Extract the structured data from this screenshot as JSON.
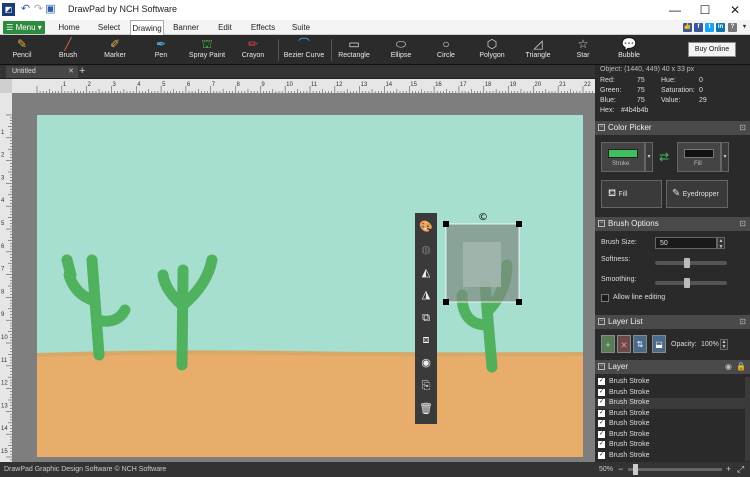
{
  "window": {
    "title": "DrawPad by NCH Software",
    "minimize": "—",
    "maximize": "☐",
    "close": "✕"
  },
  "menu_button": "Menu",
  "ribbon_tabs": [
    "Home",
    "Select",
    "Drawing",
    "Banner",
    "Edit",
    "Effects",
    "Suite"
  ],
  "active_tab": "Drawing",
  "tools": [
    {
      "label": "Pencil",
      "icon": "pencil-icon",
      "color": "#e0b040"
    },
    {
      "label": "Brush",
      "icon": "brush-icon",
      "color": "#d9693a"
    },
    {
      "label": "Marker",
      "icon": "marker-icon",
      "color": "#e0b040"
    },
    {
      "label": "Pen",
      "icon": "pen-icon",
      "color": "#4aa0e0"
    },
    {
      "label": "Spray Paint",
      "icon": "spray-paint-icon",
      "color": "#4ab84a"
    },
    {
      "label": "Crayon",
      "icon": "crayon-icon",
      "color": "#e04040"
    },
    {
      "label": "Bezier Curve",
      "icon": "bezier-curve-icon",
      "color": "#4aa0e0"
    },
    {
      "label": "Rectangle",
      "icon": "rectangle-icon",
      "color": "#cccccc"
    },
    {
      "label": "Ellipse",
      "icon": "ellipse-icon",
      "color": "#cccccc"
    },
    {
      "label": "Circle",
      "icon": "circle-icon",
      "color": "#cccccc"
    },
    {
      "label": "Polygon",
      "icon": "polygon-icon",
      "color": "#cccccc"
    },
    {
      "label": "Triangle",
      "icon": "triangle-icon",
      "color": "#cccccc"
    },
    {
      "label": "Star",
      "icon": "star-icon",
      "color": "#cccccc"
    },
    {
      "label": "Bubble",
      "icon": "bubble-icon",
      "color": "#cccccc"
    }
  ],
  "buy_online": "Buy Online",
  "document_tab": "Untitled",
  "status_text": "DrawPad Graphic Design Software © NCH Software",
  "ruler_top_labels": [
    "1",
    "2",
    "3",
    "4",
    "5",
    "6",
    "7",
    "8",
    "9",
    "10",
    "11",
    "12",
    "13",
    "14",
    "15",
    "16",
    "17",
    "18",
    "19",
    "20",
    "21",
    "22"
  ],
  "ruler_left_labels": [
    "1",
    "2",
    "3",
    "4",
    "5",
    "6",
    "7",
    "8",
    "9",
    "10",
    "11",
    "12",
    "13",
    "14",
    "15"
  ],
  "color_info": {
    "object_line": "Object:   (1440, 449) 40 x 33 px",
    "red_label": "Red:",
    "red": "75",
    "hue_label": "Hue:",
    "hue": "0",
    "green_label": "Green:",
    "green": "75",
    "sat_label": "Saturation:",
    "sat": "0",
    "blue_label": "Blue:",
    "blue": "75",
    "value_label": "Value:",
    "value": "29",
    "hex_label": "Hex:",
    "hex": "#4b4b4b"
  },
  "color_picker": {
    "title": "Color Picker",
    "stroke_label": "Stroke",
    "fill_label": "Fill",
    "fill_button": "Fill",
    "eyedropper_button": "Eyedropper",
    "stroke_color": "#3fbf5f",
    "fill_color": "#111111"
  },
  "brush_options": {
    "title": "Brush Options",
    "size_label": "Brush Size:",
    "size_value": "50",
    "softness_label": "Softness:",
    "smoothing_label": "Smoothing:",
    "line_editing_label": "Allow line editing",
    "softness": 0.45,
    "smoothing": 0.45
  },
  "layer_list": {
    "title": "Layer List",
    "opacity_label": "Opacity:",
    "opacity_value": "100%"
  },
  "layers": {
    "header": "Layer",
    "items": [
      "Brush Stroke",
      "Brush Stroke",
      "Brush Stroke",
      "Brush Stroke",
      "Brush Stroke",
      "Brush Stroke",
      "Brush Stroke",
      "Brush Stroke"
    ],
    "selected_index": 2
  },
  "zoom": {
    "value": "50%",
    "level": 0.05
  },
  "colors": {
    "sky": "#a6ded0",
    "sand": "#e8ad6b",
    "cactus": "#4caf5a",
    "accent": "#2e8a3e"
  }
}
